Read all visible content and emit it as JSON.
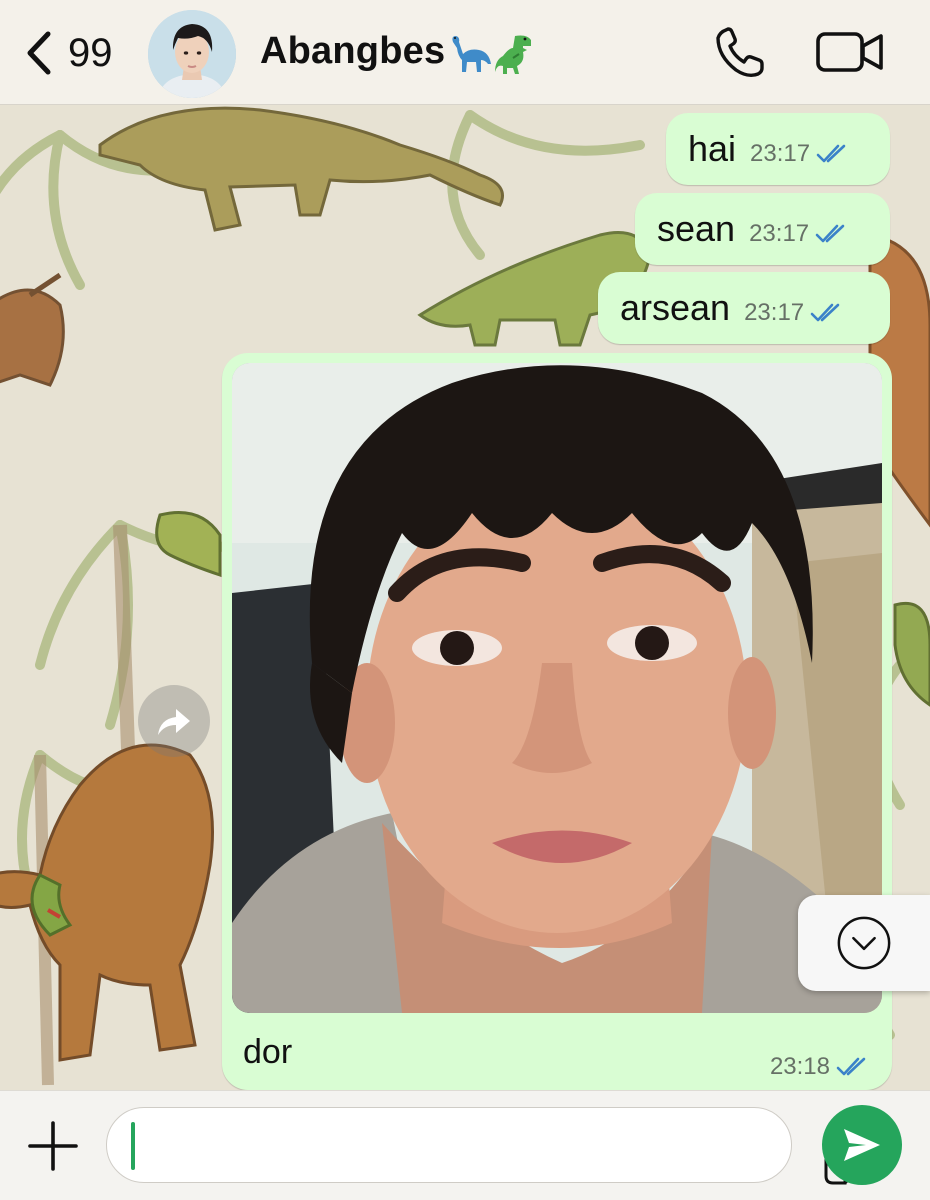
{
  "header": {
    "back_count": "99",
    "contact_name": "Abangbes",
    "contact_emoji_1": "sauropod-emoji",
    "contact_emoji_2": "t-rex-emoji",
    "call_icon": "phone-icon",
    "video_icon": "video-camera-icon"
  },
  "messages": [
    {
      "text": "hai",
      "time": "23:17",
      "status": "read"
    },
    {
      "text": "sean",
      "time": "23:17",
      "status": "read"
    },
    {
      "text": "arsean",
      "time": "23:17",
      "status": "read"
    }
  ],
  "image_message": {
    "caption": "dor",
    "time": "23:18",
    "status": "read"
  },
  "composer": {
    "placeholder": "",
    "value": ""
  },
  "colors": {
    "outgoing_bubble": "#d9fdd3",
    "read_ticks": "#3b82c9",
    "send_button": "#25a55c",
    "header_bg": "#f4f1ea"
  }
}
